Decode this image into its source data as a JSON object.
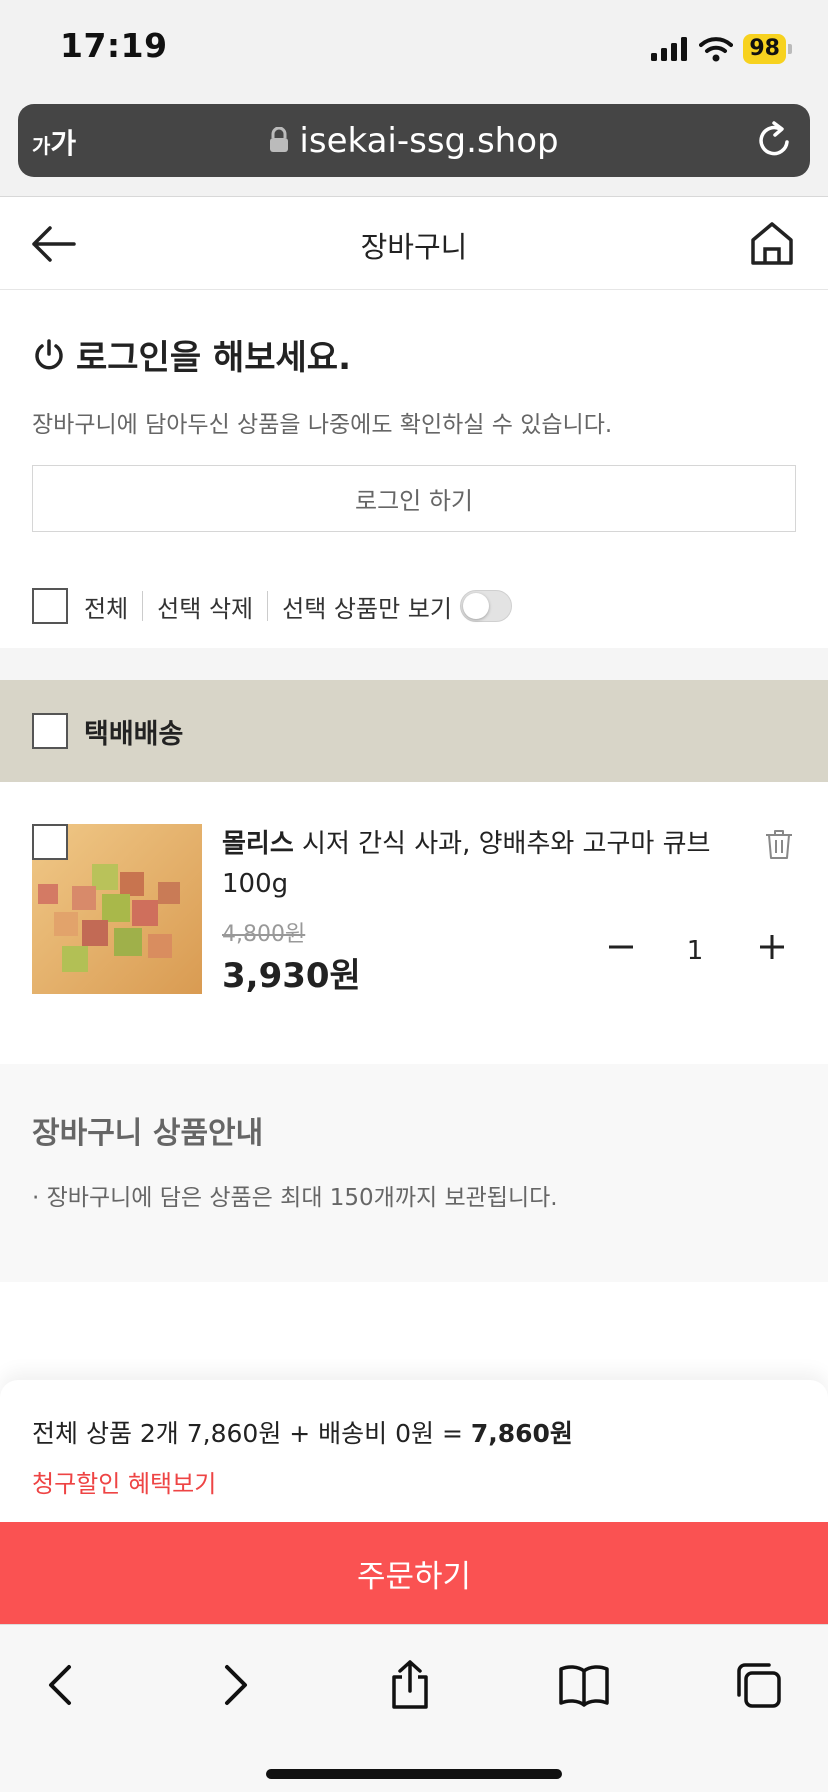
{
  "status_bar": {
    "time": "17:19",
    "battery": "98"
  },
  "browser": {
    "aa_small": "가",
    "aa_large": "가",
    "url": "isekai-ssg.shop"
  },
  "header": {
    "title": "장바구니"
  },
  "login": {
    "title": "로그인을 해보세요.",
    "description": "장바구니에 담아두신 상품을 나중에도 확인하실 수 있습니다.",
    "button": "로그인 하기"
  },
  "select_bar": {
    "all": "전체",
    "delete_selected": "선택 삭제",
    "show_selected_only": "선택 상품만 보기"
  },
  "delivery": {
    "label": "택배배송"
  },
  "product": {
    "brand": "몰리스",
    "name": " 시저 간식 사과, 양배추와 고구마 큐브 100g",
    "original_price": "4,800원",
    "sale_price": "3,930원",
    "quantity": "1"
  },
  "notice": {
    "title": "장바구니 상품안내",
    "text": "· 장바구니에 담은 상품은 최대 150개까지 보관됩니다."
  },
  "summary": {
    "text": "전체 상품 2개 7,860원 + 배송비 0원 = ",
    "total": "7,860원",
    "benefit_link": "청구할인 혜택보기"
  },
  "order": {
    "button": "주문하기"
  },
  "colors": {
    "accent": "#fa5252",
    "delivery_bg": "#d8d5c8",
    "link": "#ee4444"
  }
}
